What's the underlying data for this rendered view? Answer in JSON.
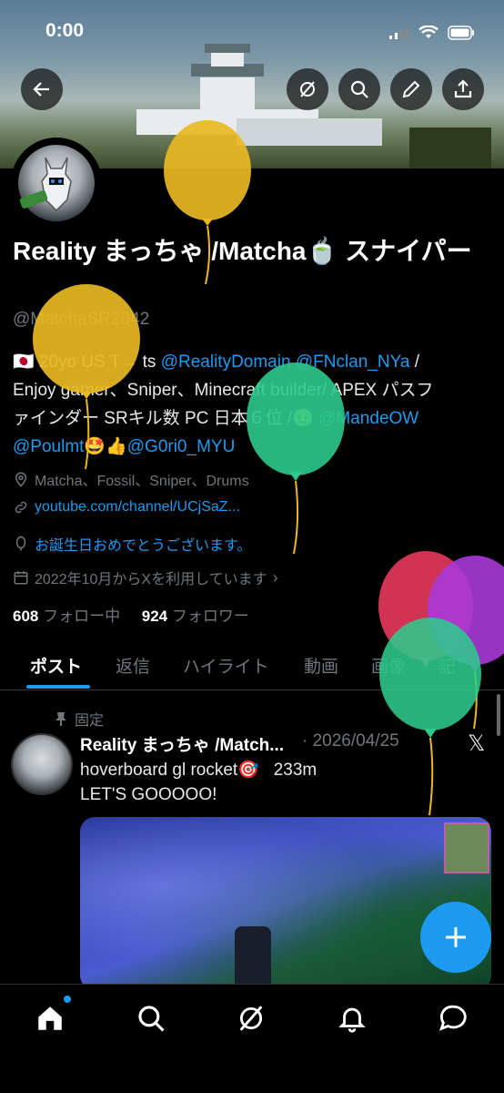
{
  "status": {
    "time": "0:00"
  },
  "header": {
    "back_icon": "arrow-left-icon",
    "actions": [
      "grok-icon",
      "search-icon",
      "edit-icon",
      "share-icon"
    ]
  },
  "profile": {
    "display_name": "Reality まっちゃ /Matcha🍵 スナイパー",
    "handle": "@MatchaSR2042",
    "bio_line1_prefix": "🇯🇵 20yo US T",
    "bio_line1_arrow": "→",
    "bio_line1_ts": " ts ",
    "bio_link1": "@RealityDomain",
    "bio_link2": "@FNclan_NYa",
    "bio_line1_suffix": " /",
    "bio_line2": "Enjoy gamer、Sniper、Minecraft builder/ APEX パスフ",
    "bio_line3_text": "ァインダー SRキル数 PC 日本６位 /🤢 ",
    "bio_link3": "@MandeOW",
    "bio_link4": "@Poulmt",
    "bio_line4_emoji": "🤩👍",
    "bio_link5": "@G0ri0_MYU",
    "location": "Matcha、Fossil、Sniper、Drums",
    "website": "youtube.com/channel/UCjSaZ...",
    "birthday": "お誕生日おめでとうございます。",
    "joined": "2022年10月からXを利用しています",
    "following_count": "608",
    "following_label": "フォロー中",
    "followers_count": "924",
    "followers_label": "フォロワー"
  },
  "tabs": [
    "ポスト",
    "返信",
    "ハイライト",
    "動画",
    "画像",
    "記"
  ],
  "post": {
    "pinned_label": "固定",
    "author": "Reality まっちゃ /Match...",
    "date": "· 2026/04/25",
    "line1_text": "hoverboard gl rocket🎯",
    "line1_distance": "233m",
    "line2": "LET'S GOOOOO!"
  },
  "fab_icon": "plus-icon",
  "bottom_nav": [
    "home-icon",
    "search-icon",
    "grok-icon",
    "bell-icon",
    "messages-icon"
  ],
  "colors": {
    "accent": "#1d9bf0",
    "background": "#000000",
    "muted": "#71767b"
  }
}
